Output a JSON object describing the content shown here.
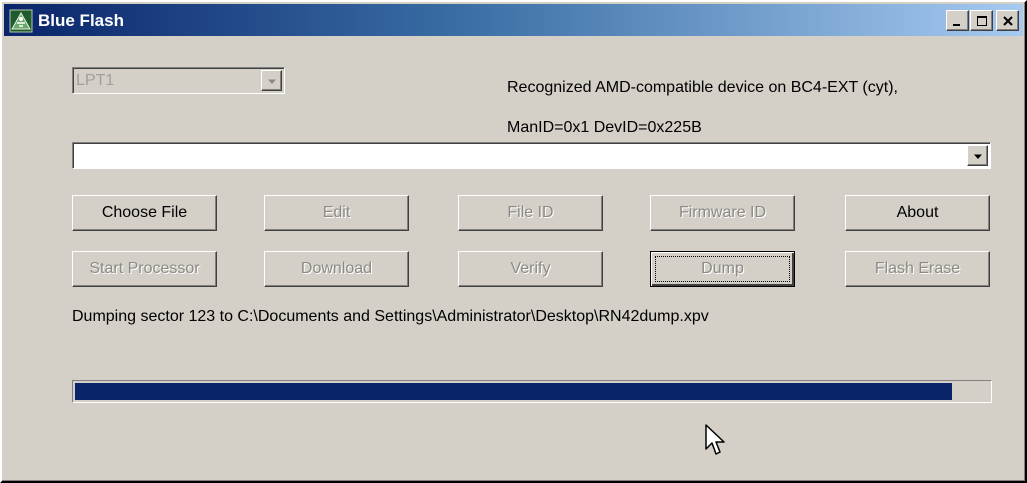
{
  "window": {
    "title": "Blue Flash",
    "controls": [
      "minimize-icon",
      "maximize-icon",
      "close-icon"
    ]
  },
  "port_select": {
    "value": "LPT1",
    "disabled": true
  },
  "device_info": {
    "line1": "Recognized AMD-compatible device on BC4-EXT (cyt),",
    "line2": "ManID=0x1 DevID=0x225B"
  },
  "file_select": {
    "value": ""
  },
  "buttons_row1": [
    {
      "label": "Choose File",
      "enabled": true
    },
    {
      "label": "Edit",
      "enabled": false
    },
    {
      "label": "File ID",
      "enabled": false
    },
    {
      "label": "Firmware ID",
      "enabled": false
    },
    {
      "label": "About",
      "enabled": true
    }
  ],
  "buttons_row2": [
    {
      "label": "Start Processor",
      "enabled": false
    },
    {
      "label": "Download",
      "enabled": false
    },
    {
      "label": "Verify",
      "enabled": false
    },
    {
      "label": "Dump",
      "enabled": false,
      "focused": true
    },
    {
      "label": "Flash Erase",
      "enabled": false
    }
  ],
  "status": "Dumping sector 123 to C:\\Documents and Settings\\Administrator\\Desktop\\RN42dump.xpv",
  "progress": {
    "percent": 96
  },
  "colors": {
    "face": "#d4d0c8",
    "title_start": "#0a246a",
    "title_end": "#a6caf0",
    "progress_fill": "#0a246a"
  }
}
